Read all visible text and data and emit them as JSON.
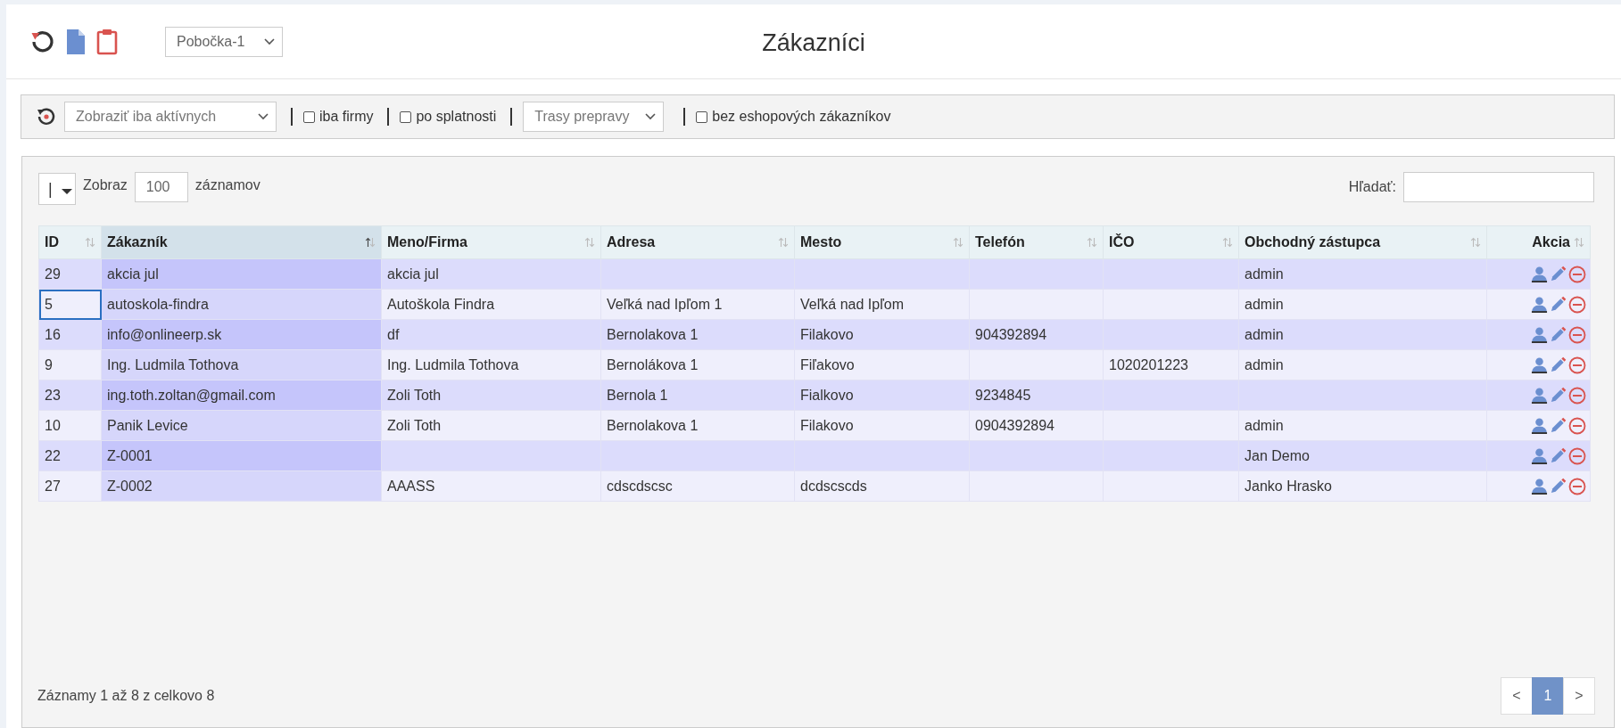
{
  "header": {
    "branch_select": "Pobočka-1",
    "title": "Zákazníci"
  },
  "filters": {
    "status_select": "Zobraziť iba aktívnych",
    "checkboxes": [
      {
        "label": "iba firmy",
        "checked": false
      },
      {
        "label": "po splatnosti",
        "checked": false
      }
    ],
    "route_select": "Trasy prepravy",
    "eshop_checkbox": {
      "label": "bez eshopových zákazníkov",
      "checked": false
    }
  },
  "table_controls": {
    "column_toggle": "|",
    "show_label": "Zobraz",
    "page_size": "100",
    "records_label": "záznamov",
    "search_label": "Hľadať:"
  },
  "table": {
    "columns": [
      {
        "label": "ID",
        "sorted": false
      },
      {
        "label": "Zákazník",
        "sorted": true
      },
      {
        "label": "Meno/Firma",
        "sorted": false
      },
      {
        "label": "Adresa",
        "sorted": false
      },
      {
        "label": "Mesto",
        "sorted": false
      },
      {
        "label": "Telefón",
        "sorted": false
      },
      {
        "label": "IČO",
        "sorted": false
      },
      {
        "label": "Obchodný zástupca",
        "sorted": false
      },
      {
        "label": "Akcia",
        "sorted": false
      }
    ],
    "rows": [
      {
        "cells": [
          "29",
          "akcia jul",
          "akcia jul",
          "",
          "",
          "",
          "",
          "admin"
        ],
        "focused": false
      },
      {
        "cells": [
          "5",
          "autoskola-findra",
          "Autoškola Findra",
          "Veľká nad Ipľom 1",
          "Veľká nad Ipľom",
          "",
          "",
          "admin"
        ],
        "focused": true
      },
      {
        "cells": [
          "16",
          "info@onlineerp.sk",
          "df",
          "Bernolakova 1",
          "Filakovo",
          "904392894",
          "",
          "admin"
        ],
        "focused": false
      },
      {
        "cells": [
          "9",
          "Ing. Ludmila Tothova",
          "Ing. Ludmila Tothova",
          "Bernolákova 1",
          "Fiľakovo",
          "",
          "1020201223",
          "admin"
        ],
        "focused": false
      },
      {
        "cells": [
          "23",
          "ing.toth.zoltan@gmail.com",
          "Zoli Toth",
          "Bernola 1",
          "Fialkovo",
          "9234845",
          "",
          ""
        ],
        "focused": false
      },
      {
        "cells": [
          "10",
          "Panik Levice",
          "Zoli Toth",
          "Bernolakova 1",
          "Filakovo",
          "0904392894",
          "",
          "admin"
        ],
        "focused": false
      },
      {
        "cells": [
          "22",
          "Z-0001",
          "",
          "",
          "",
          "",
          "",
          "Jan Demo"
        ],
        "focused": false
      },
      {
        "cells": [
          "27",
          "Z-0002",
          "AAASS",
          "cdscdscsc",
          "dcdscscds",
          "",
          "",
          "Janko Hrasko"
        ],
        "focused": false
      }
    ]
  },
  "footer": {
    "info": "Záznamy 1 až 8 z celkovo 8",
    "pagination": [
      {
        "label": "<",
        "selected": false
      },
      {
        "label": "1",
        "selected": true
      },
      {
        "label": ">",
        "selected": false
      }
    ]
  }
}
